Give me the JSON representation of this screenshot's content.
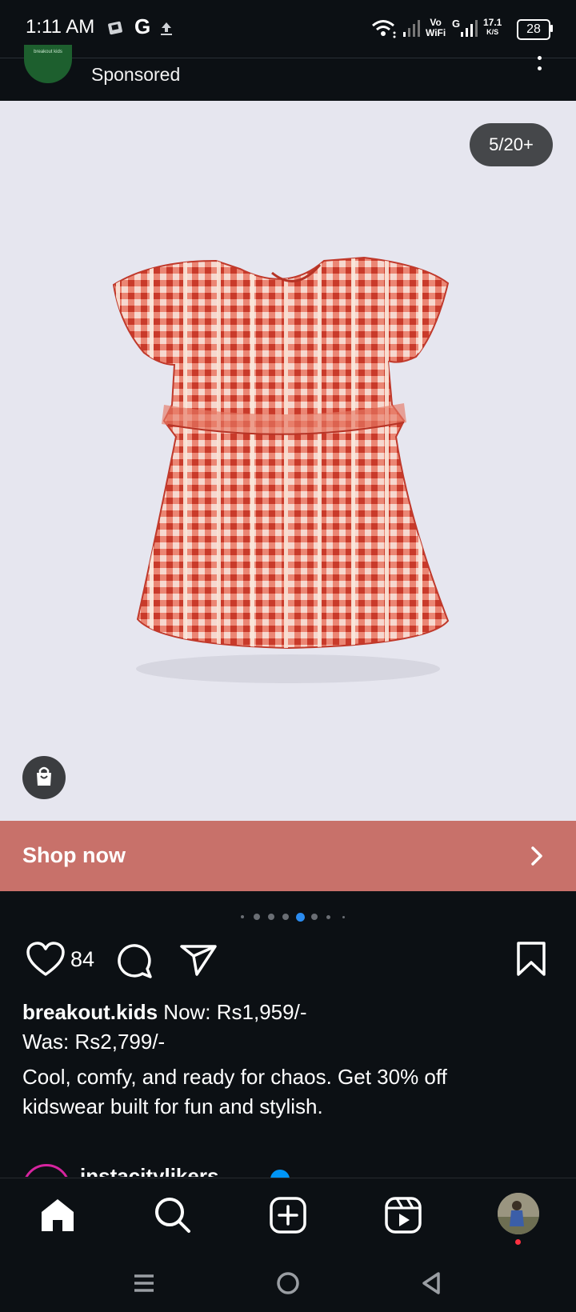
{
  "status_bar": {
    "time": "1:11 AM",
    "g_label": "G",
    "net_speed_value": "17.1",
    "net_speed_unit": "K/S",
    "vowifi_top": "Vo",
    "vowifi_bottom": "WiFi",
    "sim2_label": "G",
    "battery": "28"
  },
  "post": {
    "avatar_text": "breakout kids",
    "sponsored_label": "Sponsored",
    "image_counter": "5/20+",
    "shop_now_label": "Shop now",
    "carousel": {
      "total_dots": 8,
      "active_index": 4
    },
    "likes_count": "84",
    "username": "breakout.kids",
    "price_now": "Now: Rs1,959/-",
    "price_was": "Was: Rs2,799/-",
    "description": "Cool, comfy, and ready for chaos. Get 30% off kidswear built for fun and stylish.",
    "next_post_user": "instacitylikers"
  },
  "icons": {
    "like": "heart-icon",
    "comment": "comment-icon",
    "share": "send-icon",
    "save": "bookmark-icon",
    "home": "home-icon",
    "search": "search-icon",
    "create": "plus-square-icon",
    "reels": "reels-icon"
  },
  "colors": {
    "background": "#0c1014",
    "shop_bar": "#c8716a",
    "active_dot": "#2b8cf0",
    "media_bg": "#e6e6ef",
    "notification_dot": "#ff3040"
  }
}
